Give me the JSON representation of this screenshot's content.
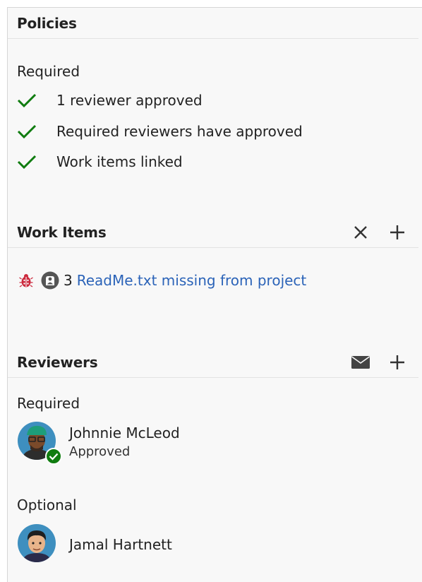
{
  "policies": {
    "title": "Policies",
    "required_label": "Required",
    "items": [
      {
        "text": "1 reviewer approved",
        "status": "passed"
      },
      {
        "text": "Required reviewers have approved",
        "status": "passed"
      },
      {
        "text": "Work items linked",
        "status": "passed"
      }
    ]
  },
  "work_items": {
    "title": "Work Items",
    "items": [
      {
        "id": "3",
        "title": "ReadMe.txt missing from project",
        "type_icon": "bug-icon",
        "state_icon": "assigned-person-icon"
      }
    ]
  },
  "reviewers": {
    "title": "Reviewers",
    "required_label": "Required",
    "optional_label": "Optional",
    "required": [
      {
        "name": "Johnnie McLeod",
        "status": "Approved"
      }
    ],
    "optional": [
      {
        "name": "Jamal Hartnett"
      }
    ]
  },
  "colors": {
    "check": "#107c10",
    "link": "#2b63b8",
    "bug": "#cc293d",
    "approved_badge": "#107c10"
  }
}
